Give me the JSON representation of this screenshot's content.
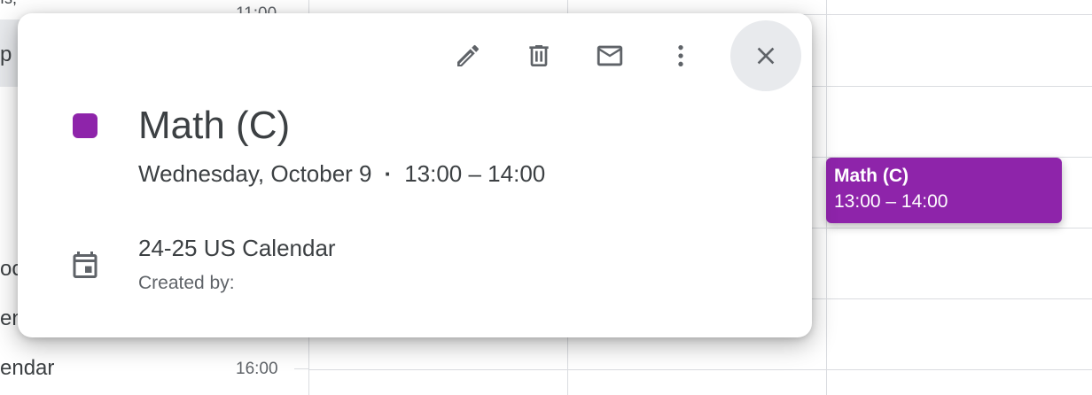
{
  "background": {
    "sidebar": {
      "partial_text_top": "ıs, ",
      "partial_text_item": "p",
      "partial_text_3": "oc",
      "partial_text_4": "en",
      "partial_text_5": "endar"
    },
    "time_labels": [
      "11:00",
      "16:00"
    ]
  },
  "event_chip": {
    "title": "Math (C)",
    "time": "13:00 – 14:00",
    "color": "#8e24aa"
  },
  "popover": {
    "toolbar": {
      "edit_icon": "pencil-icon",
      "delete_icon": "trash-icon",
      "email_icon": "mail-icon",
      "more_icon": "more-vert-icon",
      "close_icon": "close-icon"
    },
    "event": {
      "title": "Math (C)",
      "date": "Wednesday, October 9",
      "separator": "·",
      "time": "13:00 – 14:00",
      "color": "#8e24aa"
    },
    "calendar": {
      "icon": "calendar-icon",
      "name": "24-25 US Calendar",
      "created_by": "Created by:"
    }
  }
}
